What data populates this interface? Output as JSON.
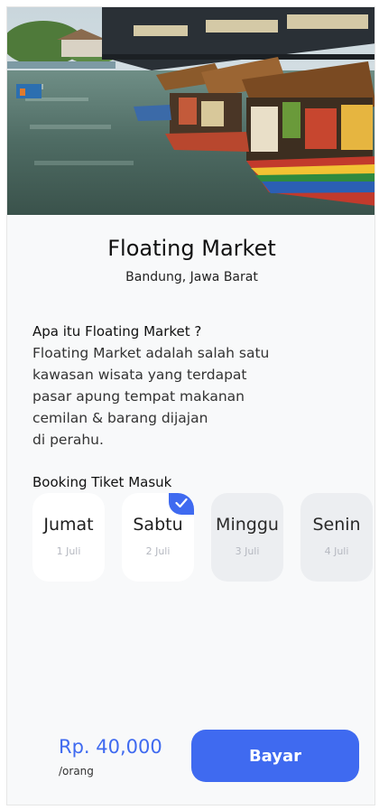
{
  "place": {
    "title": "Floating Market",
    "location": "Bandung, Jawa Barat"
  },
  "about": {
    "heading": "Apa itu Floating Market ?",
    "body": "Floating Market adalah salah satu\nkawasan wisata yang terdapat\npasar apung tempat makanan\ncemilan & barang dijajan\ndi perahu."
  },
  "booking": {
    "heading": "Booking Tiket Masuk",
    "days": [
      {
        "name": "Jumat",
        "date": "1 Juli",
        "selected": false,
        "available": true
      },
      {
        "name": "Sabtu",
        "date": "2 Juli",
        "selected": true,
        "available": true
      },
      {
        "name": "Minggu",
        "date": "3 Juli",
        "selected": false,
        "available": false
      },
      {
        "name": "Senin",
        "date": "4 Juli",
        "selected": false,
        "available": false
      }
    ]
  },
  "footer": {
    "price": "Rp. 40,000",
    "unit": "/orang",
    "pay_label": "Bayar"
  },
  "colors": {
    "accent": "#3f6af0",
    "background": "#f8f9fa"
  }
}
